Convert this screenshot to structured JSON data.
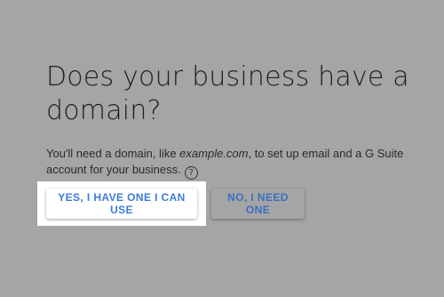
{
  "page": {
    "title": "Does your business have a domain?",
    "description_before": "You'll need a domain, like ",
    "description_example": "example.com",
    "description_after": ", to set up email and a G Suite account for your business.",
    "help_icon": "help-circle-icon",
    "help_glyph": "?"
  },
  "buttons": {
    "yes_label": "YES, I HAVE ONE I CAN USE",
    "no_label": "NO, I NEED ONE"
  },
  "colors": {
    "overlay_background": "#a5a5a5",
    "accent": "#3d7bd8",
    "highlight": "#ffffff"
  }
}
